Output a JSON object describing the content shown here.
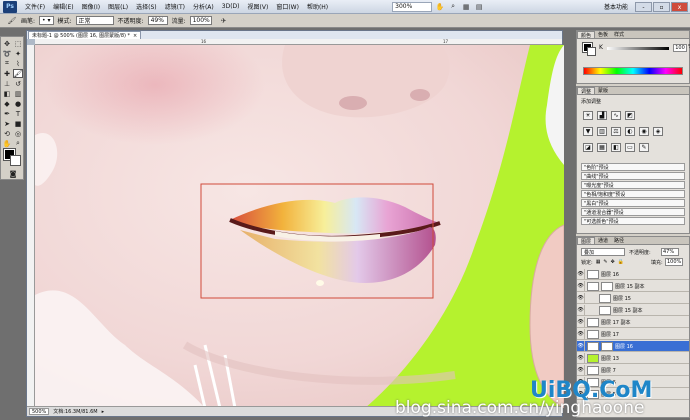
{
  "app": {
    "logo": "Ps",
    "workspace": "基本功能"
  },
  "menu": [
    "文件(F)",
    "编辑(E)",
    "图像(I)",
    "图层(L)",
    "选择(S)",
    "滤镜(T)",
    "分析(A)",
    "3D(D)",
    "视图(V)",
    "窗口(W)",
    "帮助(H)"
  ],
  "menubar": {
    "zoom": "300%"
  },
  "window_buttons": {
    "minimize": "-",
    "restore": "▫",
    "close": "x"
  },
  "options": {
    "brush_label": "画笔:",
    "mode_label": "模式:",
    "mode_value": "正常",
    "opacity_label": "不透明度:",
    "opacity_value": "49%",
    "flow_label": "流量:",
    "flow_value": "100%"
  },
  "document": {
    "tab": "未标题-1 @ 500% (图层 16, 图层蒙版/8) *",
    "ruler_ticks": [
      "16",
      "17"
    ],
    "status_zoom": "500%",
    "status_doc": "文档:16.3M/81.6M"
  },
  "color_panel": {
    "tabs": [
      "颜色",
      "色板",
      "样式"
    ],
    "k_label": "K",
    "k_value": "100",
    "k_unit": "%"
  },
  "adjust_panel": {
    "tabs": [
      "调整",
      "蒙版"
    ],
    "title": "添加调整",
    "presets": [
      "\"色阶\"预设",
      "\"曲线\"预设",
      "\"曝光度\"预设",
      "\"色相/饱和度\"预设",
      "\"黑白\"预设",
      "\"通道混合器\"预设",
      "\"可选颜色\"预设"
    ]
  },
  "layers_panel": {
    "tabs": [
      "图层",
      "通道",
      "路径"
    ],
    "blend_mode": "叠加",
    "opacity_label": "不透明度:",
    "opacity_value": "47%",
    "lock_label": "锁定:",
    "fill_label": "填充:",
    "fill_value": "100%",
    "layers": [
      {
        "name": "图层 16",
        "selected": false,
        "indent": false,
        "mask": false,
        "thumb": "#ffffff"
      },
      {
        "name": "图层 15 副本",
        "selected": false,
        "indent": false,
        "mask": true,
        "thumb": "#ffffff"
      },
      {
        "name": "图层 15",
        "selected": false,
        "indent": true,
        "mask": false,
        "thumb": "#ffffff"
      },
      {
        "name": "图层 15 副本",
        "selected": false,
        "indent": true,
        "mask": false,
        "thumb": "#ffffff"
      },
      {
        "name": "图层 17 副本",
        "selected": false,
        "indent": false,
        "mask": false,
        "thumb": "#ffffff"
      },
      {
        "name": "图层 17",
        "selected": false,
        "indent": false,
        "mask": false,
        "thumb": "#ffffff"
      },
      {
        "name": "图层 16",
        "selected": true,
        "indent": false,
        "mask": true,
        "thumb": "#ffffff"
      },
      {
        "name": "图层 13",
        "selected": false,
        "indent": false,
        "mask": false,
        "thumb": "#b5f22e"
      },
      {
        "name": "图层 7",
        "selected": false,
        "indent": false,
        "mask": false,
        "thumb": "#ffffff"
      },
      {
        "name": "图层 6",
        "selected": false,
        "indent": false,
        "mask": false,
        "thumb": "#ffffff"
      },
      {
        "name": "图层 5",
        "selected": false,
        "indent": false,
        "mask": false,
        "thumb": "#ffffff"
      }
    ]
  },
  "watermark": "blog.sina.com.cn/yinghaoone",
  "logo": "UiBQ.CoM",
  "colors": {
    "accent_green": "#b5f22e",
    "selection_blue": "#3a6fd4",
    "selection_rect": "#d04a3a"
  }
}
